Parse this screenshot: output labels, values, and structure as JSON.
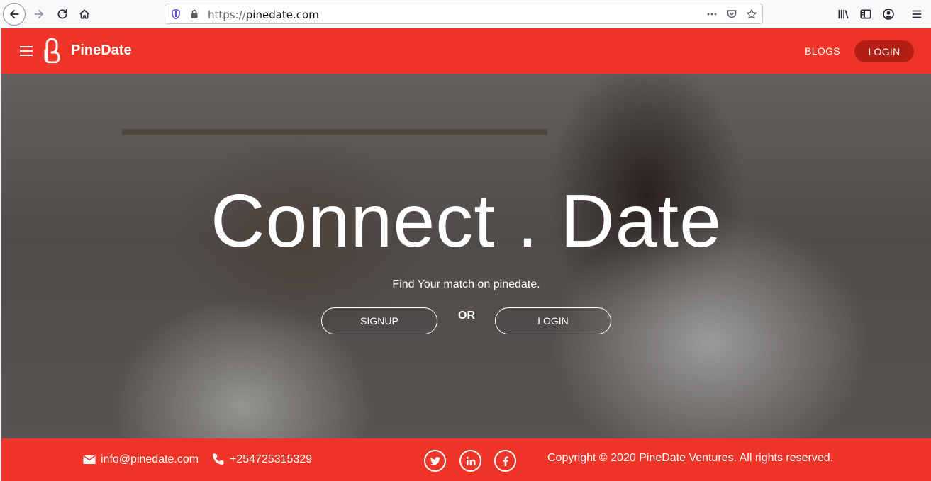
{
  "browser": {
    "url_scheme": "https://",
    "url_host": "pinedate.com"
  },
  "navbar": {
    "brand": "PineDate",
    "blogs_label": "BLOGS",
    "login_label": "LOGIN"
  },
  "hero": {
    "title": "Connect . Date",
    "subtitle": "Find Your match on pinedate.",
    "signup_label": "SIGNUP",
    "or_label": "OR",
    "login_label": "LOGIN"
  },
  "footer": {
    "email": "info@pinedate.com",
    "phone": "+254725315329",
    "copyright": "Copyright © 2020 PineDate Ventures. All rights reserved.",
    "social": [
      "twitter-icon",
      "linkedin-icon",
      "facebook-icon"
    ]
  },
  "colors": {
    "brand_red": "#ee3528",
    "login_button": "#b41e14"
  }
}
